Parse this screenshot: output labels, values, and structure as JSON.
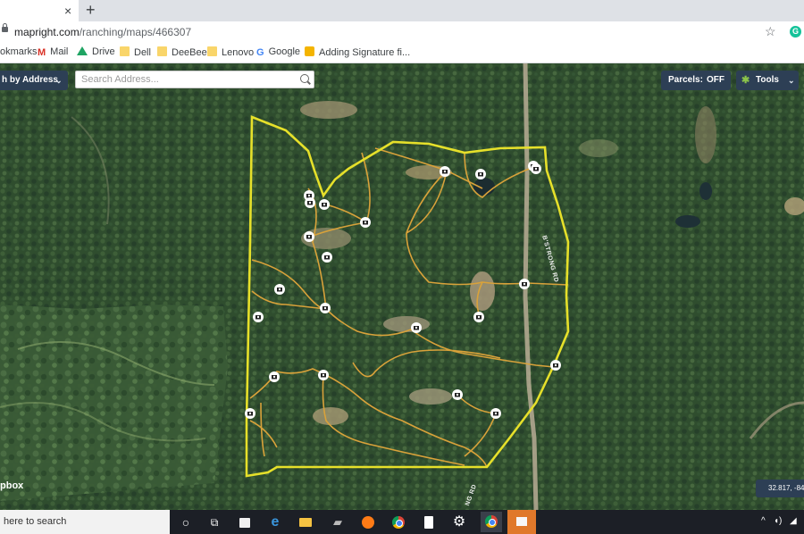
{
  "browser": {
    "tab_close": "×",
    "new_tab": "+",
    "url_host": "mapright.com",
    "url_path": "/ranching/maps/466307",
    "star_icon": "☆",
    "extension_letter": "G",
    "bookmarks": [
      {
        "label": "okmarks",
        "icon": "none"
      },
      {
        "label": "Mail",
        "icon": "gmail-icon"
      },
      {
        "label": "Drive",
        "icon": "drive-icon"
      },
      {
        "label": "Dell",
        "icon": "folder-icon"
      },
      {
        "label": "DeeBee",
        "icon": "folder-icon"
      },
      {
        "label": "Lenovo",
        "icon": "folder-icon"
      },
      {
        "label": "Google",
        "icon": "google-icon"
      },
      {
        "label": "Adding Signature fi...",
        "icon": "slides-icon"
      }
    ]
  },
  "map": {
    "search_mode_label": "h by Address",
    "search_placeholder": "Search Address...",
    "parcels_label": "Parcels:",
    "parcels_value": "OFF",
    "tools_label": "Tools",
    "road_labels": [
      "B'STRONG RD",
      "NG RD"
    ],
    "coordinates": "32.817, -84.",
    "attribution": "pbox",
    "colors": {
      "boundary": "#e6e02a",
      "trail": "#d9a23a",
      "control_bg": "#2d3f55"
    }
  },
  "taskbar": {
    "search_text": "here to search",
    "tray_icons": [
      "^",
      "speaker-icon",
      "network-icon"
    ]
  }
}
